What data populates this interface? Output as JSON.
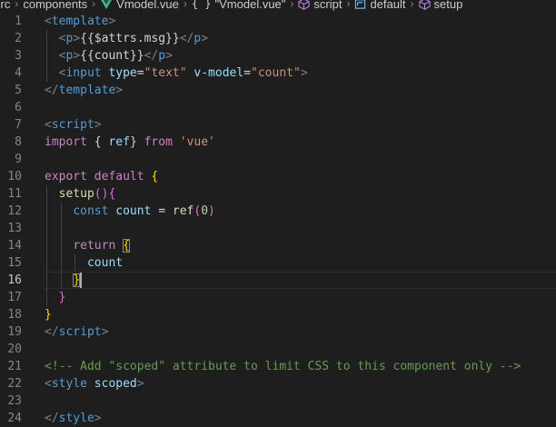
{
  "breadcrumb": {
    "items": [
      {
        "label": "src",
        "icon": ""
      },
      {
        "label": "components",
        "icon": ""
      },
      {
        "label": "Vmodel.vue",
        "icon": "vue-logo-icon"
      },
      {
        "label": "\"Vmodel.vue\"",
        "icon": "braces-icon"
      },
      {
        "label": "script",
        "icon": "cube-icon"
      },
      {
        "label": "default",
        "icon": "object-icon"
      },
      {
        "label": "setup",
        "icon": "method-icon"
      }
    ]
  },
  "editor": {
    "active_line": 16,
    "lines": [
      {
        "n": "1",
        "tokens": [
          {
            "t": "<",
            "c": "t-punct"
          },
          {
            "t": "template",
            "c": "t-tag"
          },
          {
            "t": ">",
            "c": "t-punct"
          }
        ]
      },
      {
        "n": "2",
        "tokens": [
          {
            "t": "  ",
            "c": "t-txt"
          },
          {
            "t": "<",
            "c": "t-punct"
          },
          {
            "t": "p",
            "c": "t-tag"
          },
          {
            "t": ">",
            "c": "t-punct"
          },
          {
            "t": "{{$attrs.msg}}",
            "c": "t-txt"
          },
          {
            "t": "</",
            "c": "t-punct"
          },
          {
            "t": "p",
            "c": "t-tag"
          },
          {
            "t": ">",
            "c": "t-punct"
          }
        ]
      },
      {
        "n": "3",
        "tokens": [
          {
            "t": "  ",
            "c": "t-txt"
          },
          {
            "t": "<",
            "c": "t-punct"
          },
          {
            "t": "p",
            "c": "t-tag"
          },
          {
            "t": ">",
            "c": "t-punct"
          },
          {
            "t": "{{count}}",
            "c": "t-txt"
          },
          {
            "t": "</",
            "c": "t-punct"
          },
          {
            "t": "p",
            "c": "t-tag"
          },
          {
            "t": ">",
            "c": "t-punct"
          }
        ]
      },
      {
        "n": "4",
        "tokens": [
          {
            "t": "  ",
            "c": "t-txt"
          },
          {
            "t": "<",
            "c": "t-punct"
          },
          {
            "t": "input",
            "c": "t-tag"
          },
          {
            "t": " ",
            "c": "t-txt"
          },
          {
            "t": "type",
            "c": "t-attr"
          },
          {
            "t": "=",
            "c": "t-txt"
          },
          {
            "t": "\"text\"",
            "c": "t-str"
          },
          {
            "t": " ",
            "c": "t-txt"
          },
          {
            "t": "v-model",
            "c": "t-attr"
          },
          {
            "t": "=",
            "c": "t-txt"
          },
          {
            "t": "\"count\"",
            "c": "t-str"
          },
          {
            "t": ">",
            "c": "t-punct"
          }
        ]
      },
      {
        "n": "5",
        "tokens": [
          {
            "t": "</",
            "c": "t-punct"
          },
          {
            "t": "template",
            "c": "t-tag"
          },
          {
            "t": ">",
            "c": "t-punct"
          }
        ]
      },
      {
        "n": "6",
        "tokens": []
      },
      {
        "n": "7",
        "tokens": [
          {
            "t": "<",
            "c": "t-punct"
          },
          {
            "t": "script",
            "c": "t-tag"
          },
          {
            "t": ">",
            "c": "t-punct"
          }
        ]
      },
      {
        "n": "8",
        "tokens": [
          {
            "t": "import",
            "c": "t-kw"
          },
          {
            "t": " { ",
            "c": "t-txt"
          },
          {
            "t": "ref",
            "c": "t-var"
          },
          {
            "t": "} ",
            "c": "t-txt"
          },
          {
            "t": "from",
            "c": "t-kw"
          },
          {
            "t": " ",
            "c": "t-txt"
          },
          {
            "t": "'vue'",
            "c": "t-str"
          }
        ]
      },
      {
        "n": "9",
        "tokens": []
      },
      {
        "n": "10",
        "tokens": [
          {
            "t": "export",
            "c": "t-kw"
          },
          {
            "t": " ",
            "c": "t-txt"
          },
          {
            "t": "default",
            "c": "t-kw"
          },
          {
            "t": " ",
            "c": "t-txt"
          },
          {
            "t": "{",
            "c": "t-brk"
          }
        ]
      },
      {
        "n": "11",
        "tokens": [
          {
            "t": "  ",
            "c": "t-txt"
          },
          {
            "t": "setup",
            "c": "t-fn"
          },
          {
            "t": "()",
            "c": "t-brk2"
          },
          {
            "t": "{",
            "c": "t-brk2"
          }
        ]
      },
      {
        "n": "12",
        "tokens": [
          {
            "t": "    ",
            "c": "t-txt"
          },
          {
            "t": "const",
            "c": "t-decl"
          },
          {
            "t": " ",
            "c": "t-txt"
          },
          {
            "t": "count",
            "c": "t-var"
          },
          {
            "t": " = ",
            "c": "t-txt"
          },
          {
            "t": "ref",
            "c": "t-fn"
          },
          {
            "t": "(",
            "c": "t-brk2"
          },
          {
            "t": "0",
            "c": "t-num"
          },
          {
            "t": ")",
            "c": "t-brk2"
          }
        ]
      },
      {
        "n": "13",
        "tokens": []
      },
      {
        "n": "14",
        "tokens": [
          {
            "t": "    ",
            "c": "t-txt"
          },
          {
            "t": "return",
            "c": "t-kw"
          },
          {
            "t": " ",
            "c": "t-txt"
          },
          {
            "t": "{",
            "c": "t-brk bracket-match"
          }
        ]
      },
      {
        "n": "15",
        "tokens": [
          {
            "t": "      ",
            "c": "t-txt"
          },
          {
            "t": "count",
            "c": "t-var"
          }
        ]
      },
      {
        "n": "16",
        "tokens": [
          {
            "t": "    ",
            "c": "t-txt"
          },
          {
            "t": "}",
            "c": "t-brk bracket-match"
          }
        ]
      },
      {
        "n": "17",
        "tokens": [
          {
            "t": "  ",
            "c": "t-txt"
          },
          {
            "t": "}",
            "c": "t-brk2"
          }
        ]
      },
      {
        "n": "18",
        "tokens": [
          {
            "t": "}",
            "c": "t-brk"
          }
        ]
      },
      {
        "n": "19",
        "tokens": [
          {
            "t": "</",
            "c": "t-punct"
          },
          {
            "t": "script",
            "c": "t-tag"
          },
          {
            "t": ">",
            "c": "t-punct"
          }
        ]
      },
      {
        "n": "20",
        "tokens": []
      },
      {
        "n": "21",
        "tokens": [
          {
            "t": "<!-- Add \"scoped\" attribute to limit CSS to this component only -->",
            "c": "t-cm"
          }
        ]
      },
      {
        "n": "22",
        "tokens": [
          {
            "t": "<",
            "c": "t-punct"
          },
          {
            "t": "style",
            "c": "t-tag"
          },
          {
            "t": " ",
            "c": "t-txt"
          },
          {
            "t": "scoped",
            "c": "t-attr"
          },
          {
            "t": ">",
            "c": "t-punct"
          }
        ]
      },
      {
        "n": "23",
        "tokens": []
      },
      {
        "n": "24",
        "tokens": [
          {
            "t": "</",
            "c": "t-punct"
          },
          {
            "t": "style",
            "c": "t-tag"
          },
          {
            "t": ">",
            "c": "t-punct"
          }
        ]
      }
    ]
  }
}
